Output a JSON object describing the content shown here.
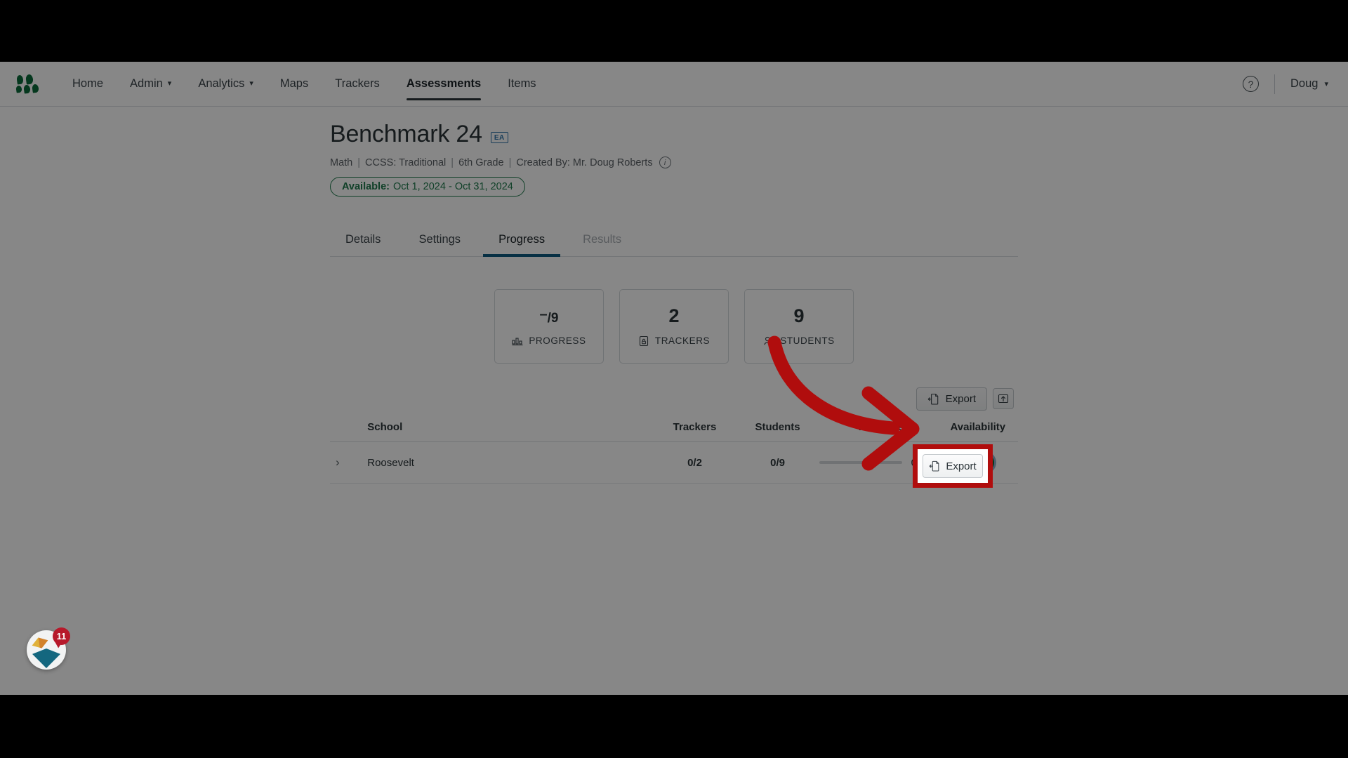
{
  "nav": {
    "logo_name": "app-logo",
    "items": [
      {
        "label": "Home",
        "has_caret": false,
        "active": false
      },
      {
        "label": "Admin",
        "has_caret": true,
        "active": false
      },
      {
        "label": "Analytics",
        "has_caret": true,
        "active": false
      },
      {
        "label": "Maps",
        "has_caret": false,
        "active": false
      },
      {
        "label": "Trackers",
        "has_caret": false,
        "active": false
      },
      {
        "label": "Assessments",
        "has_caret": false,
        "active": true
      },
      {
        "label": "Items",
        "has_caret": false,
        "active": false
      }
    ],
    "help_label": "?",
    "user_label": "Doug",
    "caret_glyph": "⌄"
  },
  "page": {
    "title": "Benchmark 24",
    "badge": "EA",
    "meta": {
      "subject": "Math",
      "standards": "CCSS: Traditional",
      "grade": "6th Grade",
      "creator": "Created By: Mr. Doug Roberts",
      "separator": "|",
      "info_glyph": "i"
    },
    "availability": {
      "label": "Available:",
      "range": "Oct 1, 2024 - Oct 31, 2024",
      "color": "#1f7a4d"
    }
  },
  "tabs": [
    {
      "label": "Details",
      "state": "normal"
    },
    {
      "label": "Settings",
      "state": "normal"
    },
    {
      "label": "Progress",
      "state": "active"
    },
    {
      "label": "Results",
      "state": "disabled"
    }
  ],
  "cards": [
    {
      "value_prefix": "–",
      "value_suffix": "/9",
      "label": "PROGRESS",
      "icon": "bar-chart-icon"
    },
    {
      "value": "2",
      "label": "TRACKERS",
      "icon": "tracker-lock-icon"
    },
    {
      "value": "9",
      "label": "STUDENTS",
      "icon": "students-icon"
    }
  ],
  "toolbar": {
    "export_label": "Export",
    "export_icon": "export-document-icon",
    "upload_icon": "upload-box-icon"
  },
  "table": {
    "headers": {
      "school": "School",
      "trackers": "Trackers",
      "students": "Students",
      "progress": "Progress",
      "availability": "Availability"
    },
    "rows": [
      {
        "expand_glyph": "›",
        "school": "Roosevelt",
        "trackers": "0/2",
        "students": "0/9",
        "progress_pct_label": "0%",
        "progress_value": 0,
        "available": true,
        "toggle_glyph": "✓"
      }
    ]
  },
  "widget": {
    "name": "help-beacon-widget",
    "badge_count": "11"
  },
  "annotation": {
    "arrow_color": "#b00d0d",
    "highlight_color": "#b00d0d",
    "points_at": "Export"
  },
  "colors": {
    "accent_tab": "#0f5c80",
    "brand_green": "#0b6b3a",
    "badge_blue": "#2f73a8",
    "available_green": "#1f7a4d",
    "annotation_red": "#b00d0d"
  }
}
